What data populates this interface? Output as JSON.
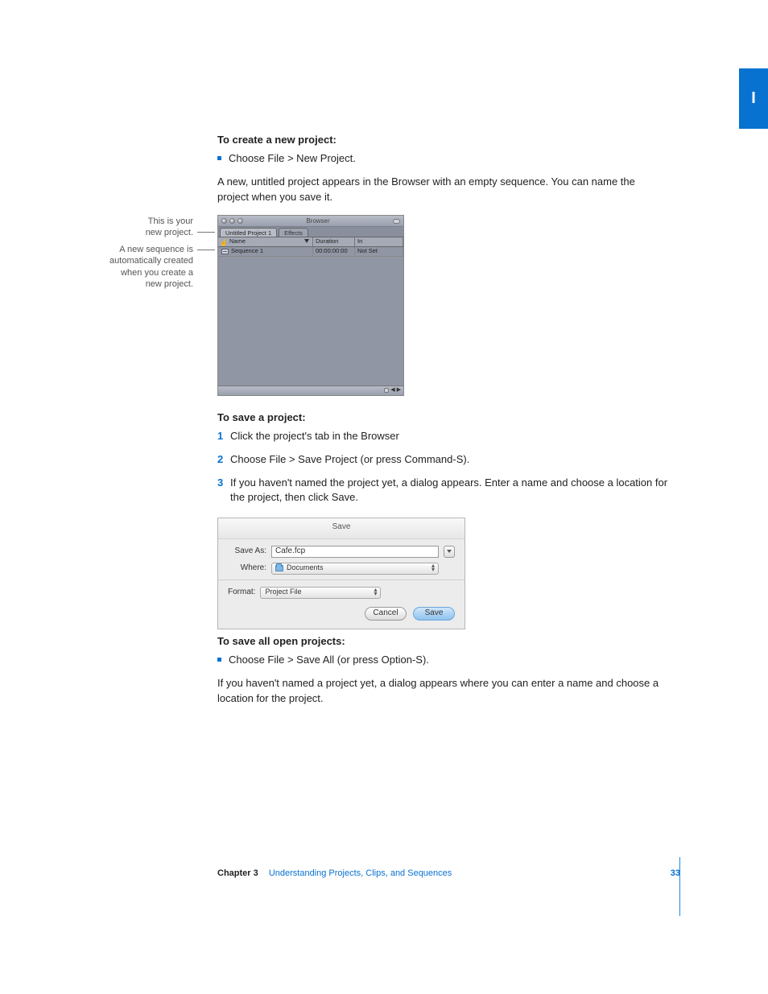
{
  "side_tab": "I",
  "section1": {
    "heading": "To create a new project:",
    "bullet": "Choose File > New Project.",
    "para": "A new, untitled project appears in the Browser with an empty sequence. You can name the project when you save it."
  },
  "callouts": {
    "c1_l1": "This is your",
    "c1_l2": "new project.",
    "c2_l1": "A new sequence is",
    "c2_l2": "automatically created",
    "c2_l3": "when you create a",
    "c2_l4": "new project."
  },
  "browser": {
    "title": "Browser",
    "tab_active": "Untitled Project 1",
    "tab_inactive": "Effects",
    "cols": {
      "name": "Name",
      "duration": "Duration",
      "in": "In"
    },
    "row": {
      "name": "Sequence 1",
      "duration": "00:00:00:00",
      "in": "Not Set"
    },
    "pager_prev": "◀",
    "pager_next": "▶"
  },
  "section2": {
    "heading": "To save a project:",
    "step1": "Click the project's tab in the Browser",
    "step2": "Choose File > Save Project (or press Command-S).",
    "step3": "If you haven't named the project yet, a dialog appears. Enter a name and choose a location for the project, then click Save.",
    "n1": "1",
    "n2": "2",
    "n3": "3"
  },
  "save_dialog": {
    "title": "Save",
    "save_as_label": "Save As:",
    "save_as_value": "Cafe.fcp",
    "where_label": "Where:",
    "where_value": "Documents",
    "format_label": "Format:",
    "format_value": "Project File",
    "cancel": "Cancel",
    "save": "Save"
  },
  "section3": {
    "heading": "To save all open projects:",
    "bullet": "Choose File > Save All (or press Option-S).",
    "para": "If you haven't named a project yet, a dialog appears where you can enter a name and choose a location for the project."
  },
  "footer": {
    "chapter": "Chapter 3",
    "title": "Understanding Projects, Clips, and Sequences",
    "page": "33"
  }
}
